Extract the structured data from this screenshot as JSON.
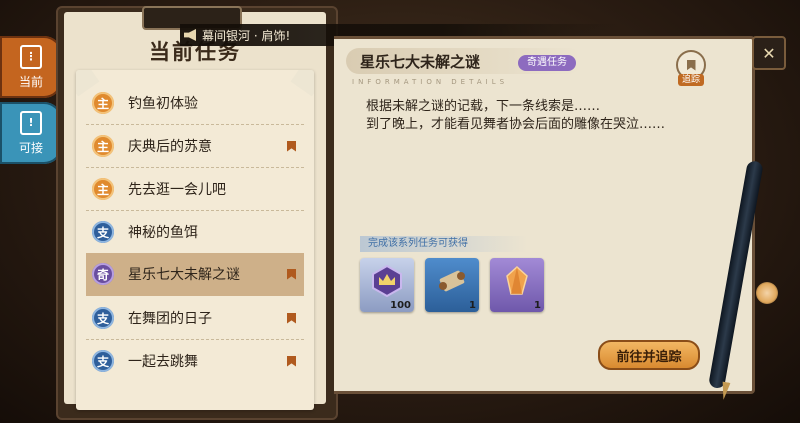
{
  "side_tabs": {
    "current_label": "当前",
    "available_label": "可接"
  },
  "panel": {
    "title": "当前任务"
  },
  "notification": {
    "text": "幕间银河 · 肩饰!"
  },
  "quests": [
    {
      "badge": "主",
      "type": "main",
      "name": "钓鱼初体验",
      "bookmarked": false,
      "selected": false
    },
    {
      "badge": "主",
      "type": "main",
      "name": "庆典后的苏意",
      "bookmarked": true,
      "selected": false
    },
    {
      "badge": "主",
      "type": "main",
      "name": "先去逛一会儿吧",
      "bookmarked": false,
      "selected": false
    },
    {
      "badge": "支",
      "type": "side",
      "name": "神秘的鱼饵",
      "bookmarked": false,
      "selected": false
    },
    {
      "badge": "奇",
      "type": "odd",
      "name": "星乐七大未解之谜",
      "bookmarked": true,
      "selected": true
    },
    {
      "badge": "支",
      "type": "side",
      "name": "在舞团的日子",
      "bookmarked": true,
      "selected": false
    },
    {
      "badge": "支",
      "type": "side",
      "name": "一起去跳舞",
      "bookmarked": true,
      "selected": false
    }
  ],
  "detail": {
    "title": "星乐七大未解之谜",
    "type_badge": "奇遇任务",
    "subtitle": "INFORMATION DETAILS",
    "track_label": "追踪",
    "description_lines": [
      "根据未解之谜的记载，下一条线索是……",
      "到了晚上，才能看见舞者协会后面的雕像在哭泣……"
    ],
    "reward_label": "完成该系列任务可获得",
    "rewards": [
      {
        "icon": "crown-badge-icon",
        "count": "100",
        "color": "#a9b7d6"
      },
      {
        "icon": "scroll-icon",
        "count": "1",
        "color": "#3d74b0"
      },
      {
        "icon": "amber-crystal-icon",
        "count": "1",
        "color": "#8a73c4"
      }
    ],
    "go_button_label": "前往并追踪"
  },
  "colors": {
    "main_badge": "#e08a2e",
    "side_badge": "#2f5f9b",
    "odd_badge": "#6a4fa0",
    "accent_orange": "#c4651f",
    "accent_blue": "#3a94b8"
  }
}
